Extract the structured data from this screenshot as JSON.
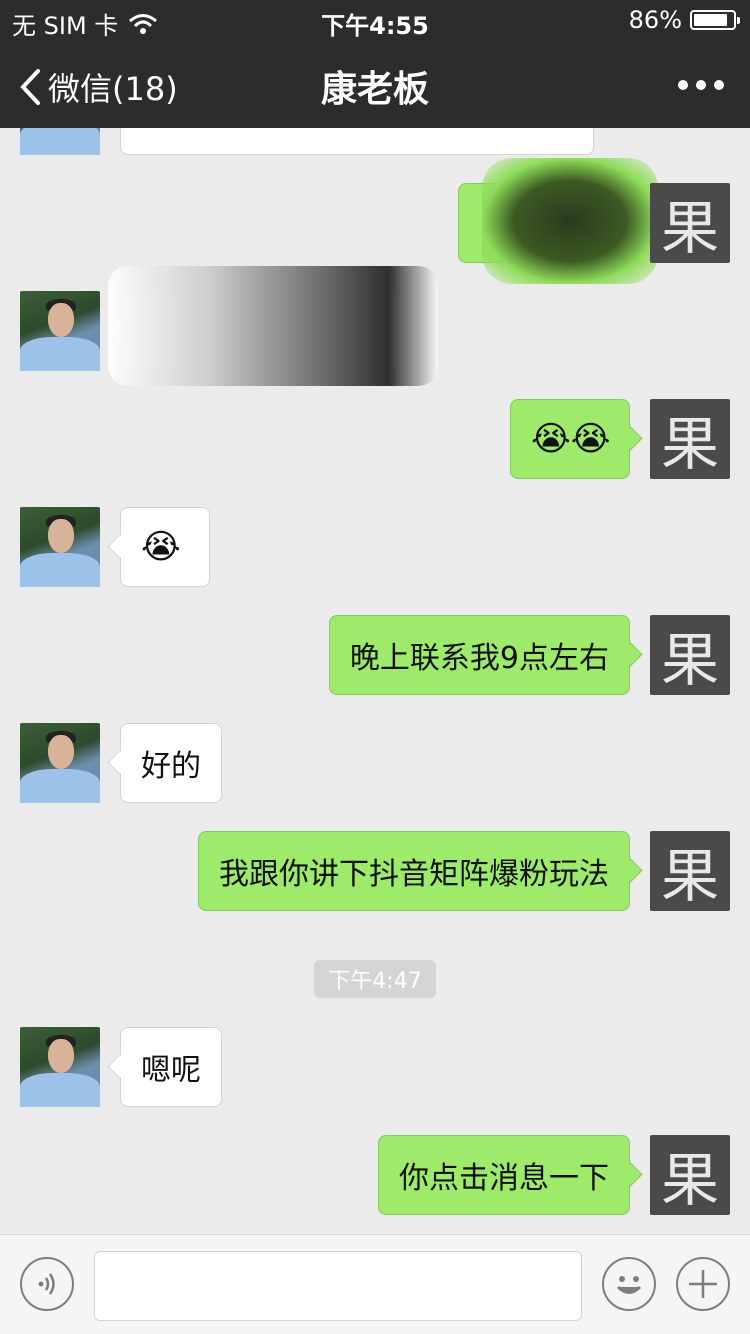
{
  "status_bar": {
    "carrier": "无 SIM 卡",
    "time": "下午4:55",
    "battery_percent_label": "86%",
    "battery_level": 0.86
  },
  "nav": {
    "back_label": "微信(18)",
    "title": "康老板"
  },
  "right_avatar_char": "果",
  "messages": {
    "m3": "😭😭",
    "m4": "😭",
    "m5": "晚上联系我9点左右",
    "m6": "好的",
    "m7": "我跟你讲下抖音矩阵爆粉玩法",
    "m8": "嗯呢",
    "m9": "你点击消息一下"
  },
  "timestamp": "下午4:47",
  "icons": {
    "back": "chevron-left-icon",
    "more": "more-dots-icon",
    "voice": "voice-icon",
    "emoji": "emoji-icon",
    "plus": "plus-icon"
  }
}
